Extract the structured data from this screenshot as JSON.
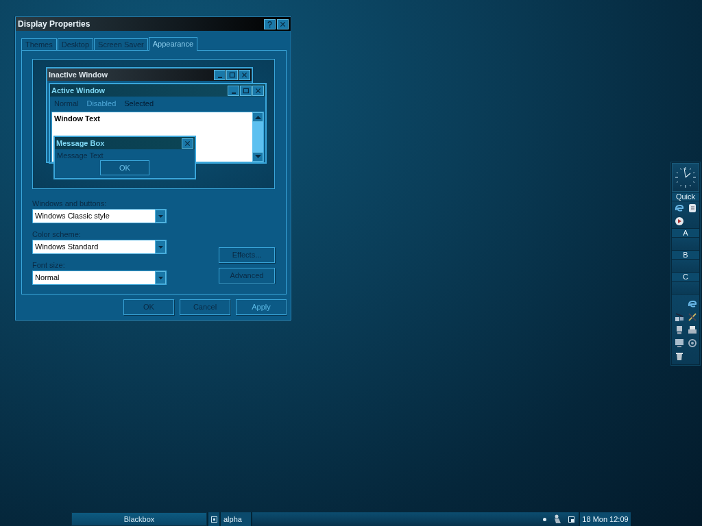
{
  "dialog": {
    "title": "Display Properties",
    "tabs": [
      {
        "label": "Themes",
        "selected": false
      },
      {
        "label": "Desktop",
        "selected": false
      },
      {
        "label": "Screen Saver",
        "selected": false
      },
      {
        "label": "Appearance",
        "selected": true
      }
    ],
    "preview": {
      "inactive_window": {
        "title": "Inactive Window"
      },
      "active_window": {
        "title": "Active Window",
        "menu": [
          {
            "label": "Normal",
            "disabled": false,
            "selected": false
          },
          {
            "label": "Disabled",
            "disabled": true,
            "selected": false
          },
          {
            "label": "Selected",
            "disabled": false,
            "selected": true
          }
        ],
        "window_text": "Window Text"
      },
      "message_box": {
        "title": "Message Box",
        "text": "Message Text",
        "button": "OK"
      }
    },
    "fields": [
      {
        "label": "Windows and buttons:",
        "value": "Windows Classic style"
      },
      {
        "label": "Color scheme:",
        "value": "Windows Standard"
      },
      {
        "label": "Font size:",
        "value": "Normal"
      }
    ],
    "side_buttons": [
      "Effects...",
      "Advanced"
    ],
    "buttons": [
      {
        "label": "OK",
        "disabled": false
      },
      {
        "label": "Cancel",
        "disabled": false
      },
      {
        "label": "Apply",
        "disabled": true
      }
    ]
  },
  "slit": {
    "sections": [
      {
        "title": "Quick"
      },
      {
        "title": "A"
      },
      {
        "title": "B"
      },
      {
        "title": "C"
      }
    ]
  },
  "taskbar": {
    "workspace": "Blackbox",
    "window": "alpha",
    "clock": "18 Mon 12:09"
  }
}
